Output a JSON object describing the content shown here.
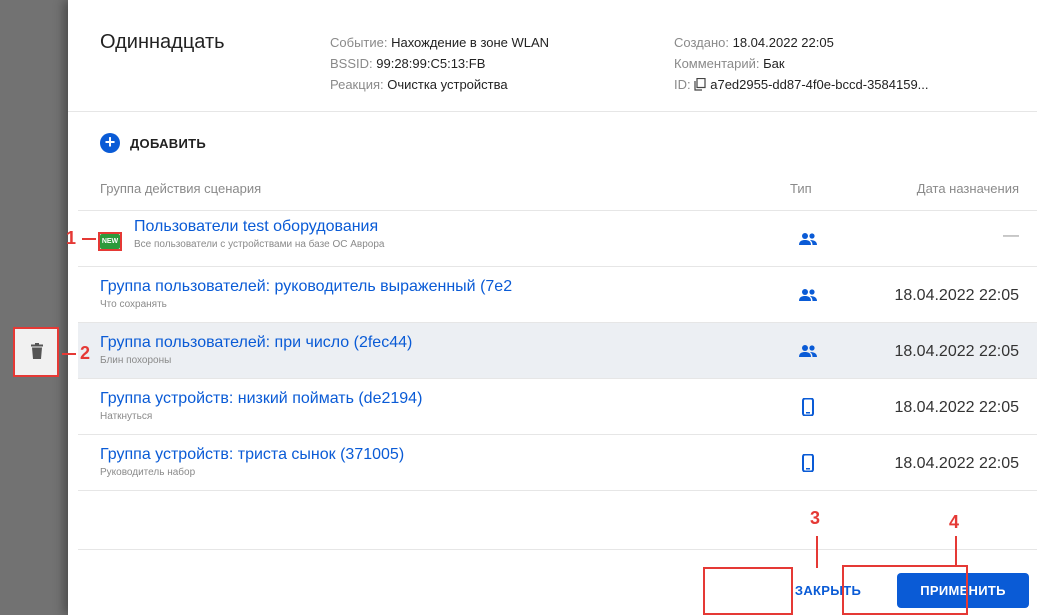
{
  "dialog": {
    "title": "Одиннадцать",
    "meta_left": [
      {
        "label": "Событие: ",
        "value": "Нахождение в зоне WLAN"
      },
      {
        "label": "BSSID: ",
        "value": "99:28:99:C5:13:FB"
      },
      {
        "label": "Реакция: ",
        "value": "Очистка устройства"
      }
    ],
    "meta_right": [
      {
        "label": "Создано: ",
        "value": "18.04.2022 22:05"
      },
      {
        "label": "Комментарий: ",
        "value": "Бак"
      },
      {
        "label": "ID: ",
        "value": "a7ed2955-dd87-4f0e-bccd-3584159..."
      }
    ]
  },
  "add_label": "ДОБАВИТЬ",
  "table": {
    "headers": {
      "group": "Группа действия сценария",
      "type": "Тип",
      "date": "Дата назначения"
    },
    "rows": [
      {
        "title": "Пользователи test оборудования",
        "subtitle": "Все пользователи с устройствами на базе ОС Аврора",
        "type": "users-icon",
        "date": "—",
        "badge": "NEW"
      },
      {
        "title": "Группа пользователей: руководитель выраженный (7e2",
        "subtitle": "Что сохранять",
        "type": "users-icon",
        "date": "18.04.2022 22:05"
      },
      {
        "title": "Группа пользователей: при число (2fec44)",
        "subtitle": "Блин похороны",
        "type": "users-icon",
        "date": "18.04.2022 22:05"
      },
      {
        "title": "Группа устройств: низкий поймать (de2194)",
        "subtitle": "Наткнуться",
        "type": "phone-icon",
        "date": "18.04.2022 22:05"
      },
      {
        "title": "Группа устройств: триста сынок (371005)",
        "subtitle": "Руководитель набор",
        "type": "phone-icon",
        "date": "18.04.2022 22:05"
      }
    ]
  },
  "buttons": {
    "close": "ЗАКРЫТЬ",
    "apply": "ПРИМЕНИТЬ"
  },
  "callouts": [
    "1",
    "2",
    "3",
    "4"
  ],
  "colors": {
    "accent": "#0a5bd6",
    "callout": "#e53935",
    "badge": "#2c9a3b"
  }
}
